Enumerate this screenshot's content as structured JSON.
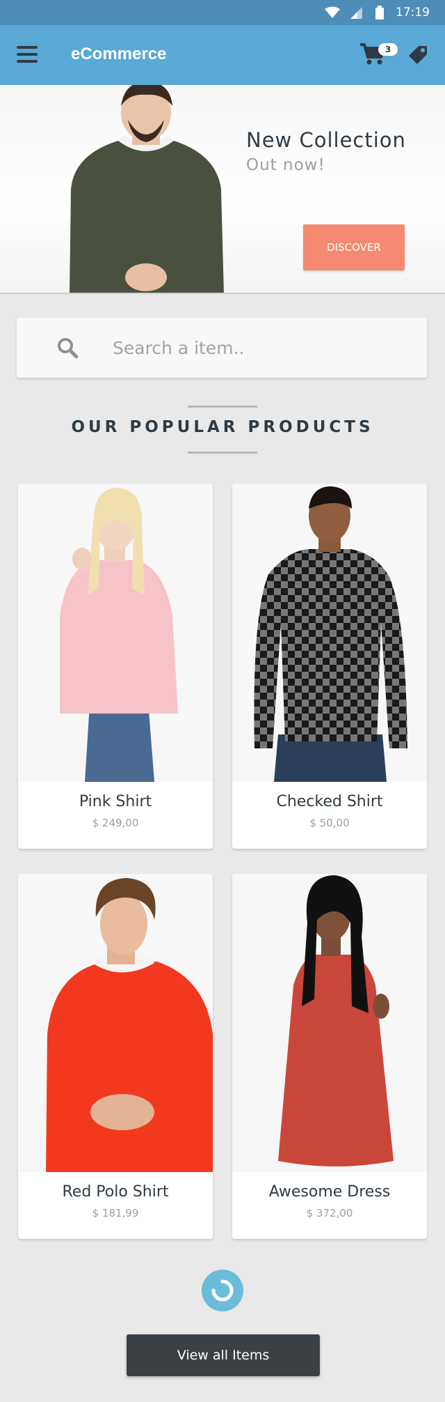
{
  "status_bar": {
    "time": "17:19"
  },
  "app_bar": {
    "title": "eCommerce",
    "cart_count": "3"
  },
  "hero": {
    "title": "New Collection",
    "subtitle": "Out now!",
    "button_label": "DISCOVER"
  },
  "search": {
    "placeholder": "Search a item.."
  },
  "section": {
    "title": "OUR POPULAR PRODUCTS"
  },
  "products": [
    {
      "name": "Pink Shirt",
      "price": "$ 249,00"
    },
    {
      "name": "Checked Shirt",
      "price": "$ 50,00"
    },
    {
      "name": "Red Polo Shirt",
      "price": "$ 181,99"
    },
    {
      "name": "Awesome Dress",
      "price": "$ 372,00"
    }
  ],
  "footer": {
    "view_all_label": "View all Items"
  },
  "colors": {
    "status_bar": "#4d8db7",
    "app_bar": "#5aa9d6",
    "accent_button": "#f58a72",
    "dark_button": "#3b4045",
    "loader": "#6bbcd8"
  }
}
